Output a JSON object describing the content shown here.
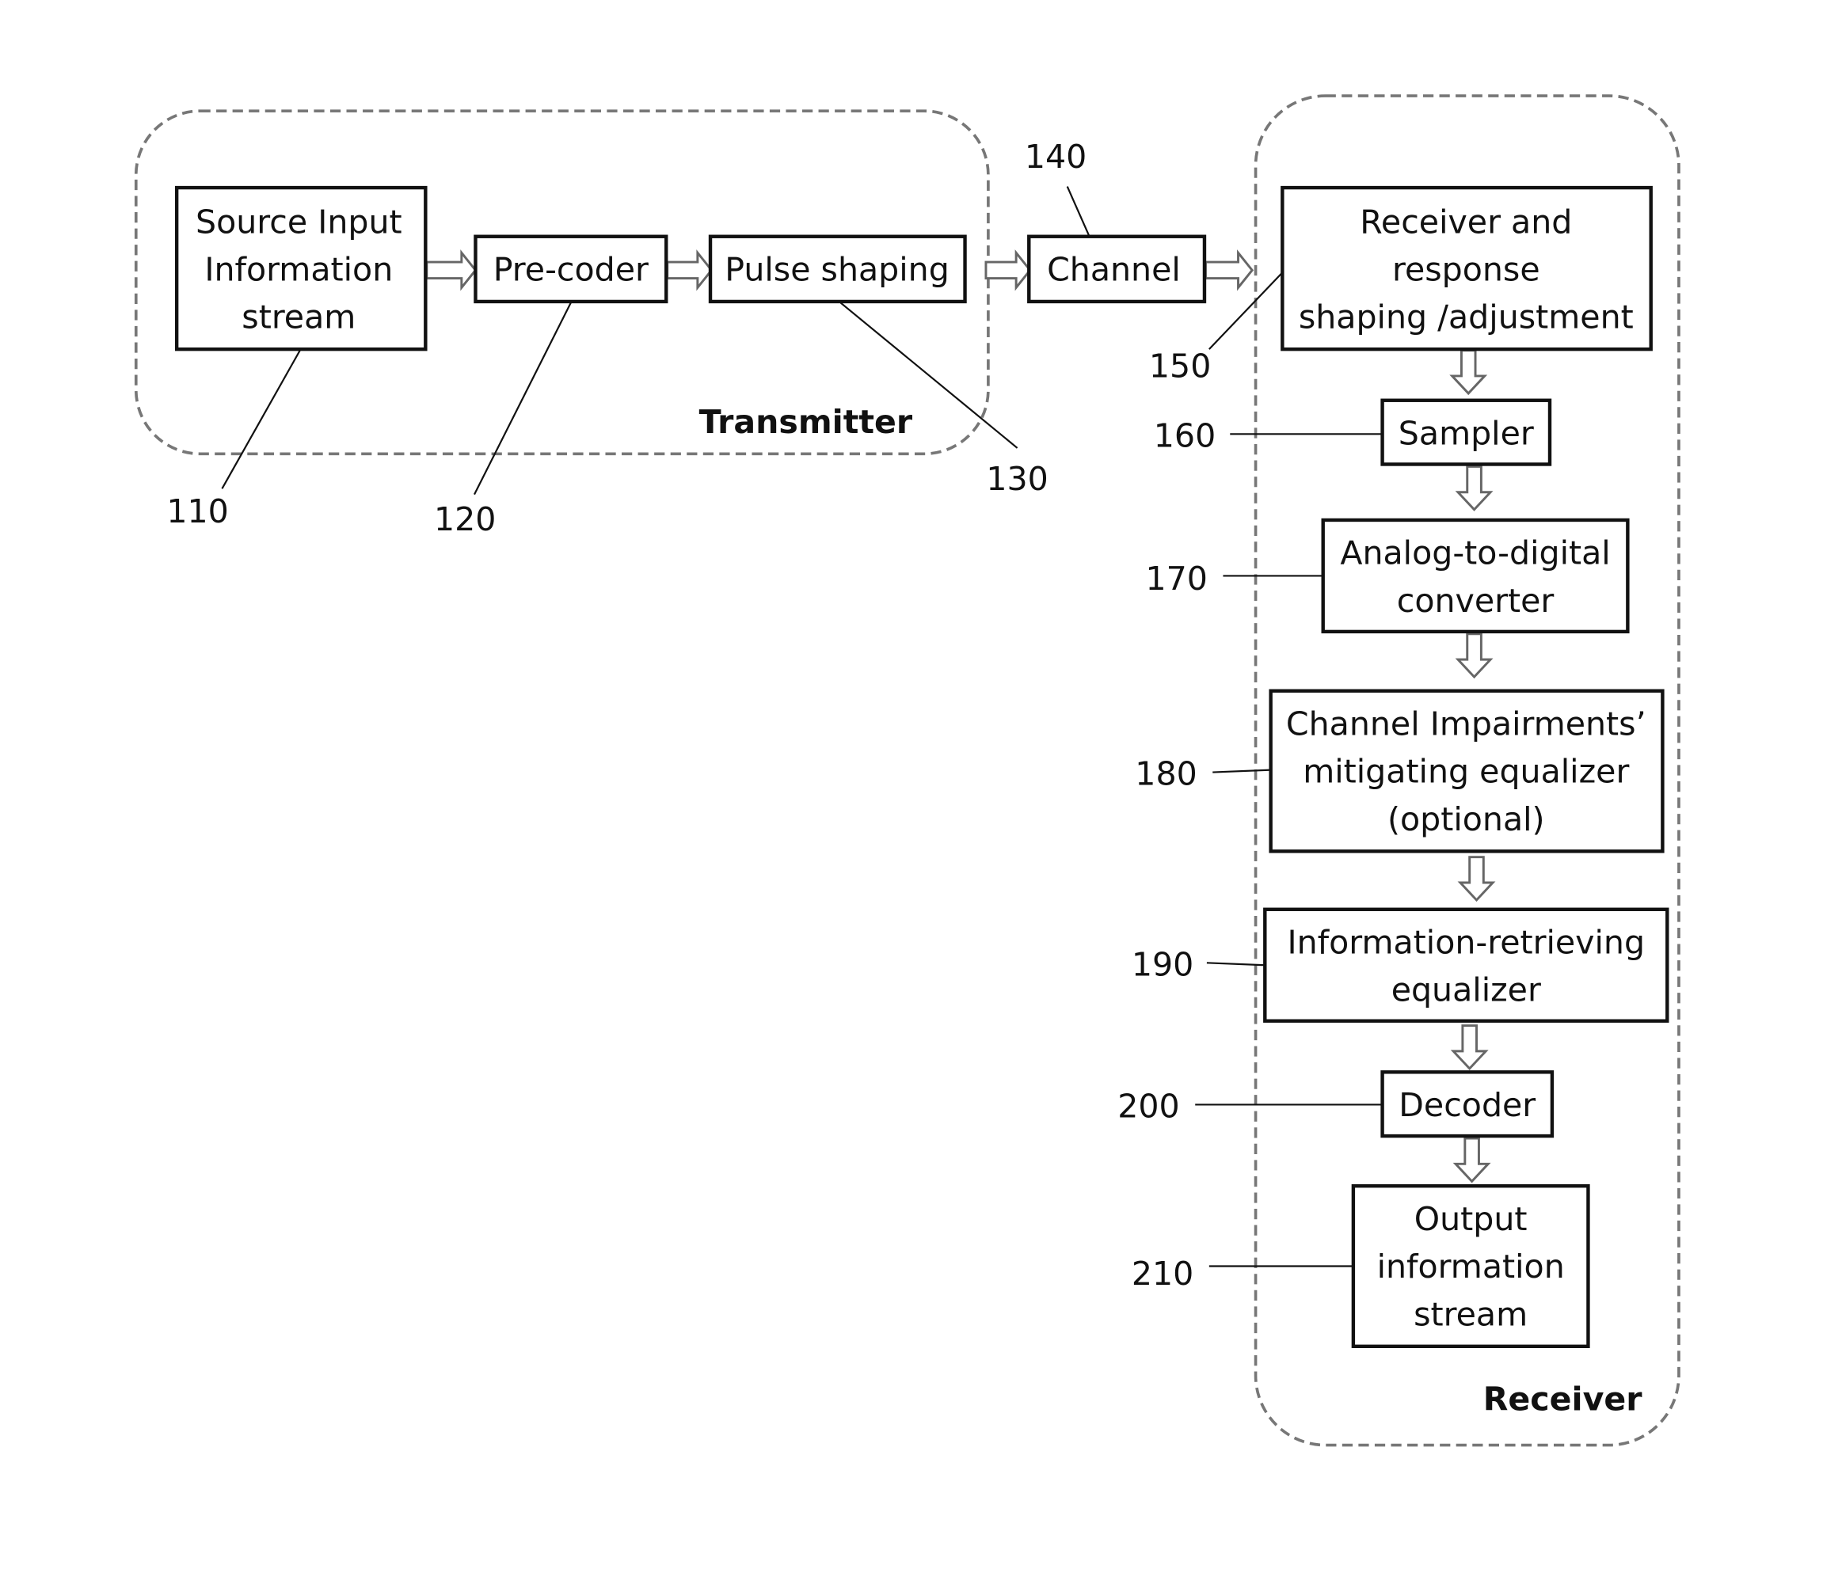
{
  "diagram": {
    "groups": {
      "transmitter": "Transmitter",
      "receiver": "Receiver"
    },
    "blocks": [
      {
        "id": "110",
        "lines": [
          "Source Input",
          "Information",
          "stream"
        ]
      },
      {
        "id": "120",
        "lines": [
          "Pre-coder"
        ]
      },
      {
        "id": "130",
        "lines": [
          "Pulse shaping"
        ]
      },
      {
        "id": "140",
        "lines": [
          "Channel"
        ]
      },
      {
        "id": "150",
        "lines": [
          "Receiver and",
          "response",
          "shaping /adjustment"
        ]
      },
      {
        "id": "160",
        "lines": [
          "Sampler"
        ]
      },
      {
        "id": "170",
        "lines": [
          "Analog-to-digital",
          "converter"
        ]
      },
      {
        "id": "180",
        "lines": [
          "Channel Impairments’",
          "mitigating equalizer",
          "(optional)"
        ]
      },
      {
        "id": "190",
        "lines": [
          "Information-retrieving",
          "equalizer"
        ]
      },
      {
        "id": "200",
        "lines": [
          "Decoder"
        ]
      },
      {
        "id": "210",
        "lines": [
          "Output",
          "information",
          "stream"
        ]
      }
    ],
    "reference_numerals": [
      "110",
      "120",
      "130",
      "140",
      "150",
      "160",
      "170",
      "180",
      "190",
      "200",
      "210"
    ]
  }
}
